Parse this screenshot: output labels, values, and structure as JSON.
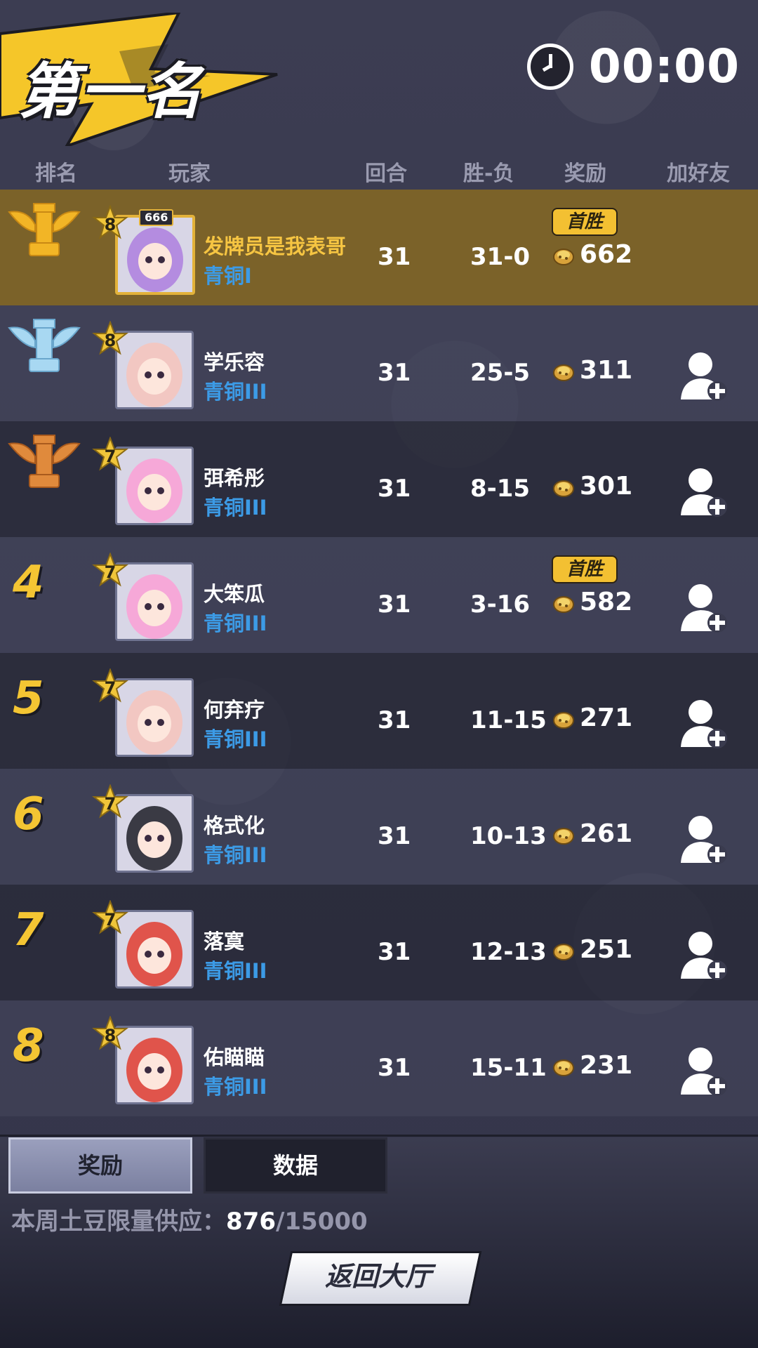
{
  "header": {
    "title": "第一名",
    "timer": "00:00"
  },
  "columns": {
    "rank": "排名",
    "player": "玩家",
    "round": "回合",
    "win_loss": "胜-负",
    "reward": "奖励",
    "add_friend": "加好友"
  },
  "rows": [
    {
      "rank": "1",
      "rank_icon": "gold-trophy-icon",
      "star_level": "8",
      "level_tag": "666",
      "name": "发牌员是我表哥",
      "tier": "青铜I",
      "round": "31",
      "wl": "31-0",
      "reward": "662",
      "badge": "首胜"
    },
    {
      "rank": "2",
      "rank_icon": "silver-trophy-icon",
      "star_level": "8",
      "name": "学乐容",
      "tier": "青铜III",
      "round": "31",
      "wl": "25-5",
      "reward": "311"
    },
    {
      "rank": "3",
      "rank_icon": "bronze-trophy-icon",
      "star_level": "7",
      "name": "弭希彤",
      "tier": "青铜III",
      "round": "31",
      "wl": "8-15",
      "reward": "301"
    },
    {
      "rank": "4",
      "star_level": "7",
      "name": "大笨瓜",
      "tier": "青铜III",
      "round": "31",
      "wl": "3-16",
      "reward": "582",
      "badge": "首胜"
    },
    {
      "rank": "5",
      "star_level": "7",
      "name": "何弃疗",
      "tier": "青铜III",
      "round": "31",
      "wl": "11-15",
      "reward": "271"
    },
    {
      "rank": "6",
      "star_level": "7",
      "name": "格式化",
      "tier": "青铜III",
      "round": "31",
      "wl": "10-13",
      "reward": "261"
    },
    {
      "rank": "7",
      "star_level": "7",
      "name": "落寞",
      "tier": "青铜III",
      "round": "31",
      "wl": "12-13",
      "reward": "251"
    },
    {
      "rank": "8",
      "star_level": "8",
      "name": "佑瞄瞄",
      "tier": "青铜III",
      "round": "31",
      "wl": "15-11",
      "reward": "231"
    }
  ],
  "tabs": {
    "reward": "奖励",
    "data": "数据"
  },
  "supply": {
    "label": "本周土豆限量供应：",
    "current": "876",
    "total": "/15000"
  },
  "back_button": "返回大厅",
  "colors": {
    "accent_gold": "#f4c533",
    "winner_row": "#7b6229",
    "tier_blue": "#3c9be6",
    "background": "#3a3b4e"
  }
}
